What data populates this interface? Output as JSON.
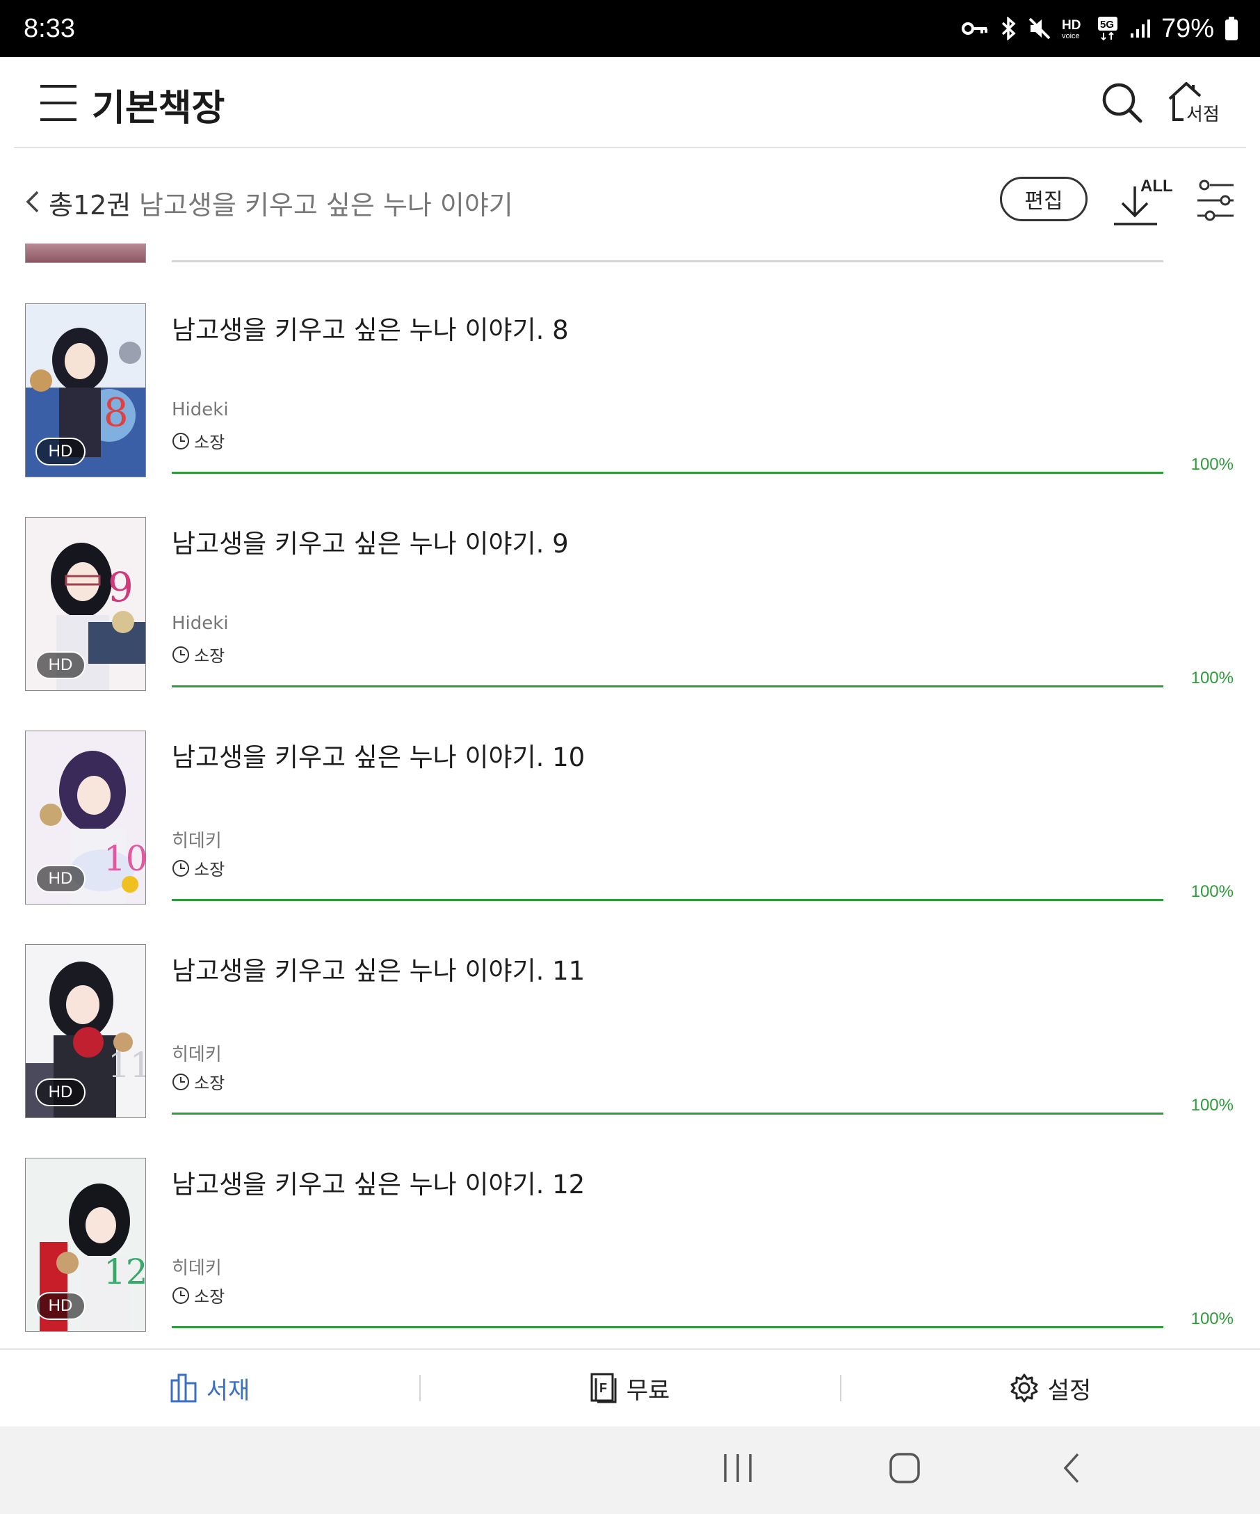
{
  "status_bar": {
    "time": "8:33",
    "battery_percent": "79%",
    "icons": [
      "vpn-key-icon",
      "bluetooth-icon",
      "mute-icon",
      "hd-voice-icon",
      "5g-icon",
      "signal-icon",
      "battery-icon"
    ],
    "hd_label": "HD",
    "voice_label": "voice",
    "net_label": "5G"
  },
  "header": {
    "title": "기본책장",
    "store_label": "서점"
  },
  "subheader": {
    "count": "총12권",
    "series_title": "남고생을 키우고 싶은 누나 이야기",
    "edit_label": "편집",
    "download_all_label": "ALL"
  },
  "books": [
    {
      "title": "남고생을 키우고 싶은 누나 이야기. 8",
      "author": "Hideki",
      "owned_label": "소장",
      "progress": 100,
      "progress_text": "100%",
      "badge": "HD"
    },
    {
      "title": "남고생을 키우고 싶은 누나 이야기. 9",
      "author": "Hideki",
      "owned_label": "소장",
      "progress": 100,
      "progress_text": "100%",
      "badge": "HD"
    },
    {
      "title": "남고생을 키우고 싶은 누나 이야기. 10",
      "author": "히데키",
      "owned_label": "소장",
      "progress": 100,
      "progress_text": "100%",
      "badge": "HD"
    },
    {
      "title": "남고생을 키우고 싶은 누나 이야기. 11",
      "author": "히데키",
      "owned_label": "소장",
      "progress": 100,
      "progress_text": "100%",
      "badge": "HD"
    },
    {
      "title": "남고생을 키우고 싶은 누나 이야기. 12",
      "author": "히데키",
      "owned_label": "소장",
      "progress": 100,
      "progress_text": "100%",
      "badge": "HD"
    }
  ],
  "tabs": [
    {
      "label": "서재",
      "icon": "bookshelf-icon",
      "active": true
    },
    {
      "label": "무료",
      "icon": "free-book-icon",
      "active": false
    },
    {
      "label": "설정",
      "icon": "settings-gear-icon",
      "active": false
    }
  ],
  "colors": {
    "accent_green": "#2e9c3a",
    "active_tab_blue": "#3b6fc4",
    "status_bar_bg": "#000000"
  }
}
